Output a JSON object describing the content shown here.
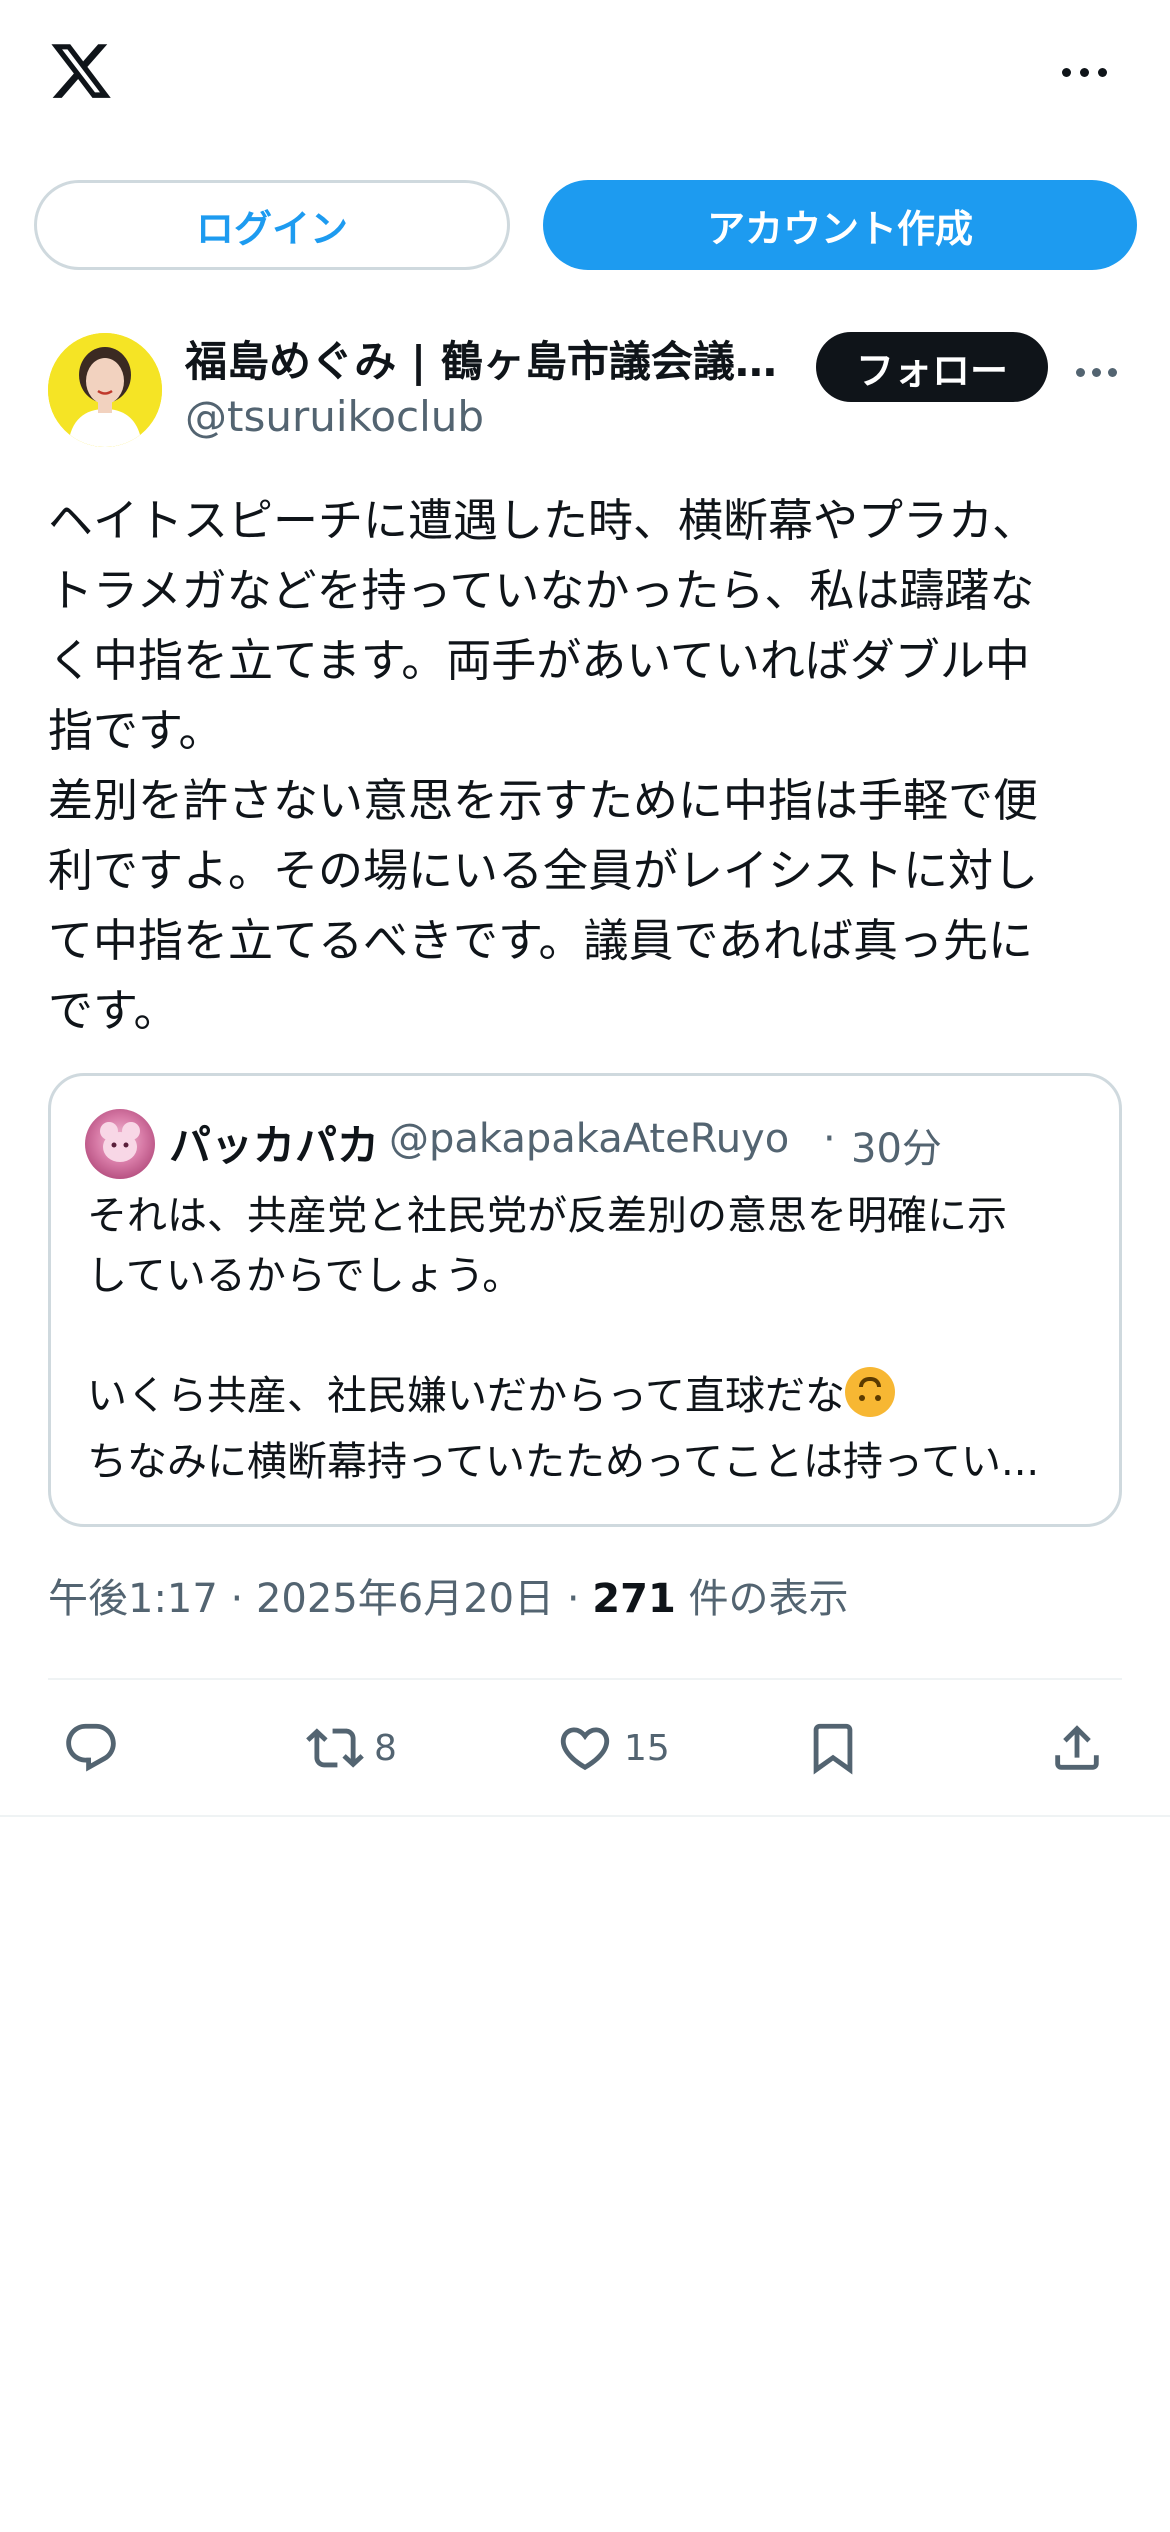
{
  "header": {
    "logo_icon": "x-logo-icon",
    "more_icon": "more-horizontal-icon"
  },
  "auth": {
    "login_label": "ログイン",
    "signup_label": "アカウント作成"
  },
  "post": {
    "author_name": "福島めぐみ | 鶴ヶ島市議会議…",
    "author_handle": "@tsuruikoclub",
    "follow_label": "フォロー",
    "text": "ヘイトスピーチに遭遇した時、横断幕やプラカ、\nトラメガなどを持っていなかったら、私は躊躇な\nく中指を立てます。両手があいていればダブル中\n指です。\n差別を許さない意思を示すために中指は手軽で便\n利ですよ。その場にいる全員がレイシストに対し\nて中指を立てるべきです。議員であれば真っ先に\nです。",
    "quote": {
      "author_name": "パッカパカ",
      "author_handle": "@pakapakaAteRuyo",
      "time": "30分",
      "text": "それは、共産党と社民党が反差別の意思を明確に示\nしているからでしょう。\n\nいくら共産、社民嫌いだからって直球だな",
      "emoji": "upside-down-face-emoji",
      "last_line": "ちなみに横断幕持っていたためってことは持ってい..."
    },
    "meta": {
      "time": "午後1:17",
      "date": "2025年6月20日",
      "views_count": "271",
      "views_label": "件の表示"
    },
    "actions": {
      "reply_icon": "reply-icon",
      "retweet_icon": "retweet-icon",
      "retweet_count": "8",
      "like_icon": "heart-icon",
      "like_count": "15",
      "bookmark_icon": "bookmark-icon",
      "share_icon": "share-icon"
    }
  },
  "colors": {
    "accent": "#1d9bf0",
    "text": "#0f1419",
    "secondary_text": "#536471",
    "border": "#cfd9de",
    "avatar_bg": "#f5e425"
  }
}
